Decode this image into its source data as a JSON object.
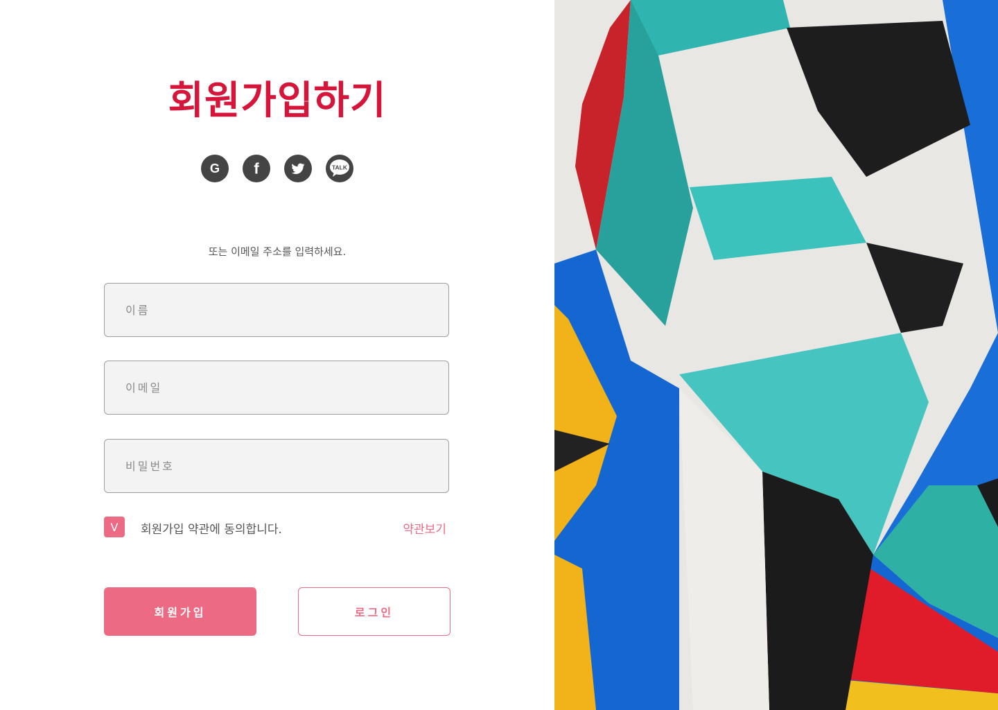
{
  "title": "회원가입하기",
  "social": [
    {
      "icon": "google-icon",
      "glyph": "G"
    },
    {
      "icon": "facebook-icon",
      "glyph": "f"
    },
    {
      "icon": "twitter-icon",
      "glyph": "bird"
    },
    {
      "icon": "kakaotalk-icon",
      "glyph": "TALK"
    }
  ],
  "subtitle": "또는 이메일 주소를 입력하세요.",
  "form": {
    "name_placeholder": "이름",
    "name_value": "",
    "email_placeholder": "이메일",
    "email_value": "",
    "password_placeholder": "비밀번호",
    "password_value": ""
  },
  "agree": {
    "checked": true,
    "check_mark": "V",
    "text": "회원가입 약관에 동의합니다.",
    "terms_link": "약관보기"
  },
  "buttons": {
    "signup": "회원가입",
    "login": "로그인"
  },
  "colors": {
    "accent": "#ec6a83",
    "title": "#d6153a",
    "icon_bg": "#444444",
    "input_bg": "#f3f3f3"
  }
}
